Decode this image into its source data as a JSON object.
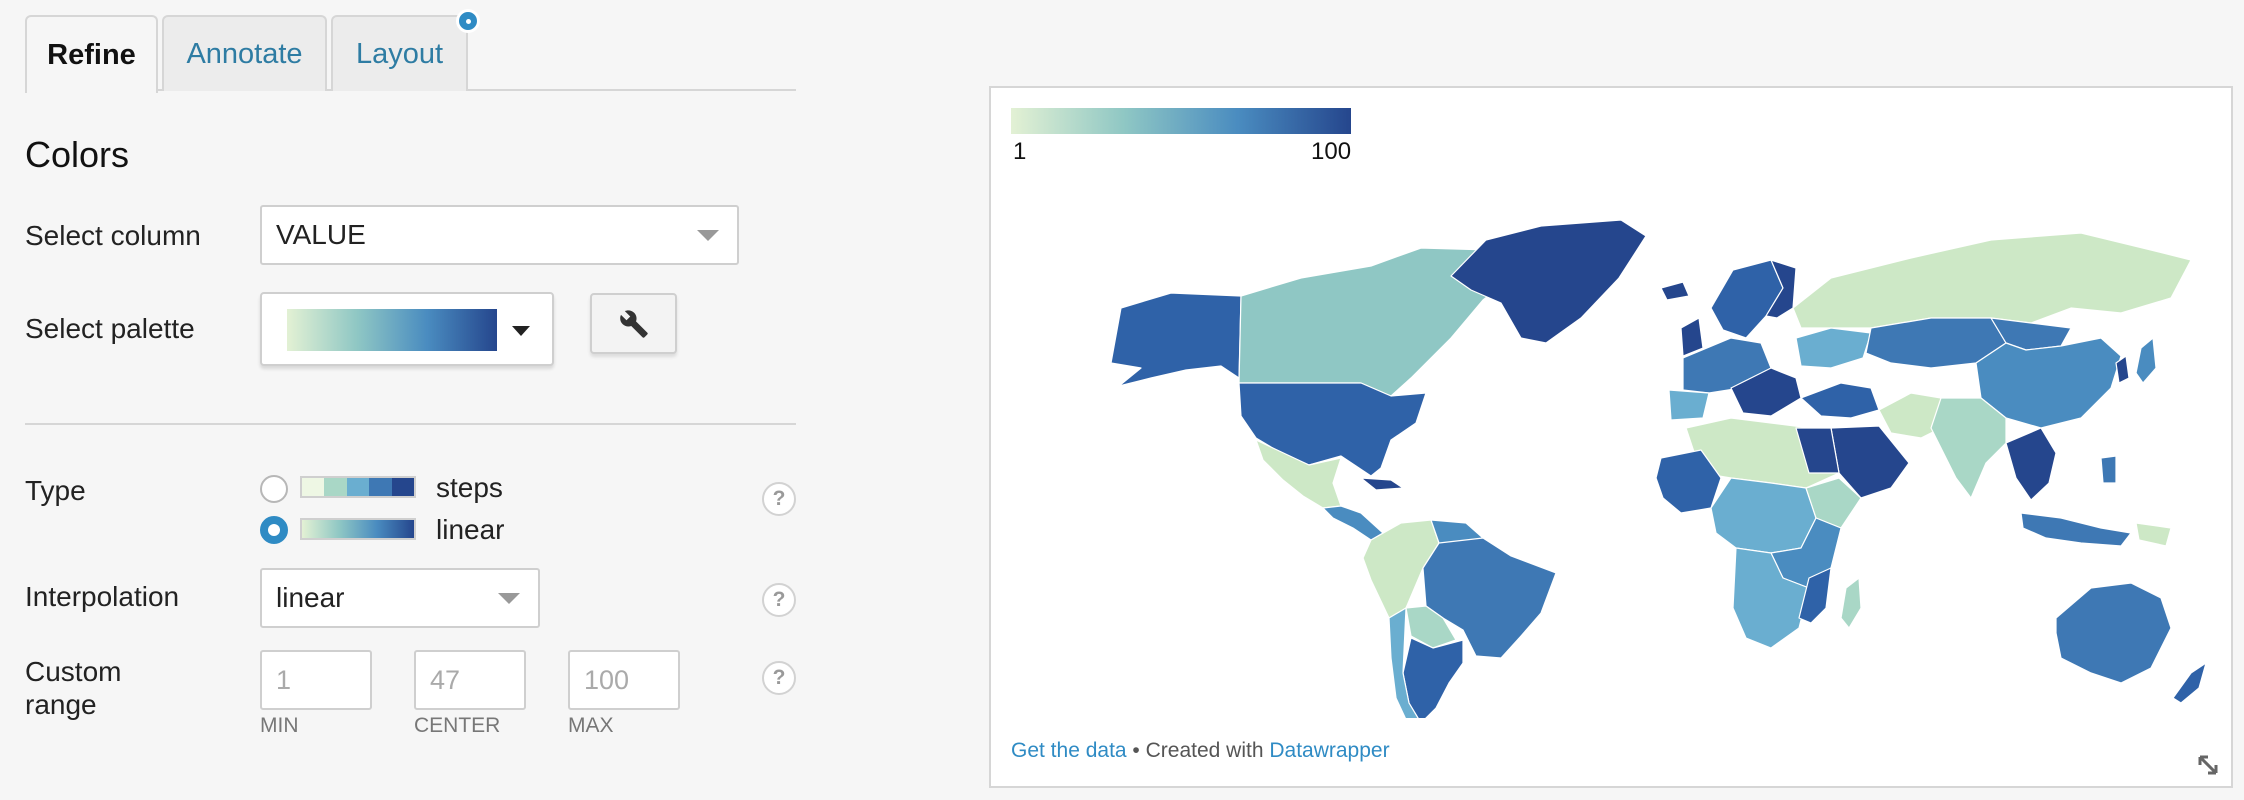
{
  "tabs": [
    {
      "label": "Refine",
      "active": true
    },
    {
      "label": "Annotate",
      "active": false
    },
    {
      "label": "Layout",
      "active": false,
      "has_notification_dot": true
    }
  ],
  "colors": {
    "heading": "Colors",
    "select_column": {
      "label": "Select column",
      "value": "VALUE"
    },
    "select_palette": {
      "label": "Select palette",
      "palette": [
        "#e3f1d4",
        "#8fc7c4",
        "#4a8cc0",
        "#25468d"
      ]
    },
    "type": {
      "label": "Type",
      "options": [
        {
          "label": "steps",
          "checked": false
        },
        {
          "label": "linear",
          "checked": true
        }
      ]
    },
    "interpolation": {
      "label": "Interpolation",
      "value": "linear"
    },
    "custom_range": {
      "label_line1": "Custom",
      "label_line2": "range",
      "min": {
        "placeholder": "1",
        "caption": "MIN"
      },
      "center": {
        "placeholder": "47",
        "caption": "CENTER"
      },
      "max": {
        "placeholder": "100",
        "caption": "MAX"
      }
    },
    "help_glyph": "?"
  },
  "preview": {
    "legend": {
      "min": "1",
      "max": "100"
    },
    "footer": {
      "get_data": "Get the data",
      "separator": " • Created with ",
      "tool": "Datawrapper"
    }
  },
  "icons": {
    "wrench": "wrench-icon",
    "help": "help-icon",
    "resize": "resize-icon"
  },
  "accent_color": "#2f8bc4"
}
